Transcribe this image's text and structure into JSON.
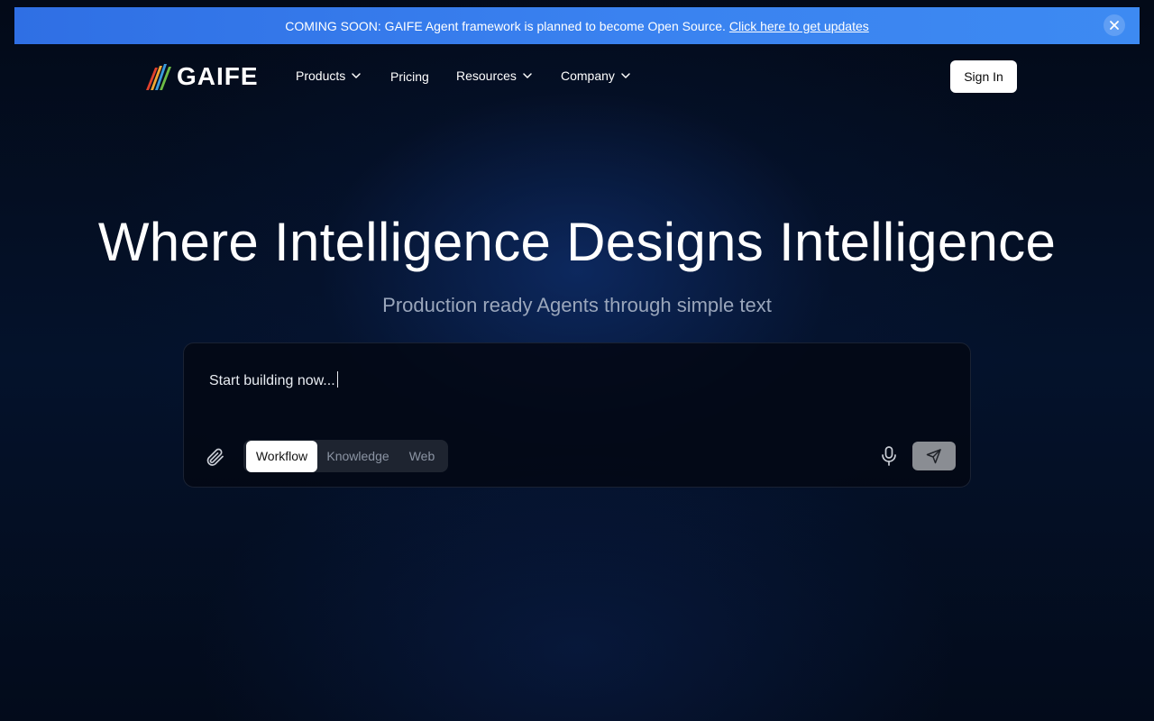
{
  "announcement": {
    "message": "COMING SOON: GAIFE Agent framework is planned to become Open Source.",
    "link_text": "Click here to get updates",
    "close_icon": "close-icon"
  },
  "nav": {
    "brand": "GAIFE",
    "items": [
      {
        "label": "Products",
        "has_dropdown": true
      },
      {
        "label": "Pricing",
        "has_dropdown": false
      },
      {
        "label": "Resources",
        "has_dropdown": true
      },
      {
        "label": "Company",
        "has_dropdown": true
      }
    ],
    "sign_in": "Sign In"
  },
  "hero": {
    "title": "Where Intelligence Designs Intelligence",
    "subtitle": "Production ready Agents through simple text"
  },
  "composer": {
    "prompt_text": "Start building now...",
    "modes": [
      "Workflow",
      "Knowledge",
      "Web"
    ],
    "active_mode": "Workflow",
    "icons": {
      "attach": "paperclip-icon",
      "mic": "microphone-icon",
      "send": "send-icon"
    }
  },
  "colors": {
    "banner": "#3a82f0",
    "background": "#030a18",
    "send_button": "#8a8d93"
  }
}
